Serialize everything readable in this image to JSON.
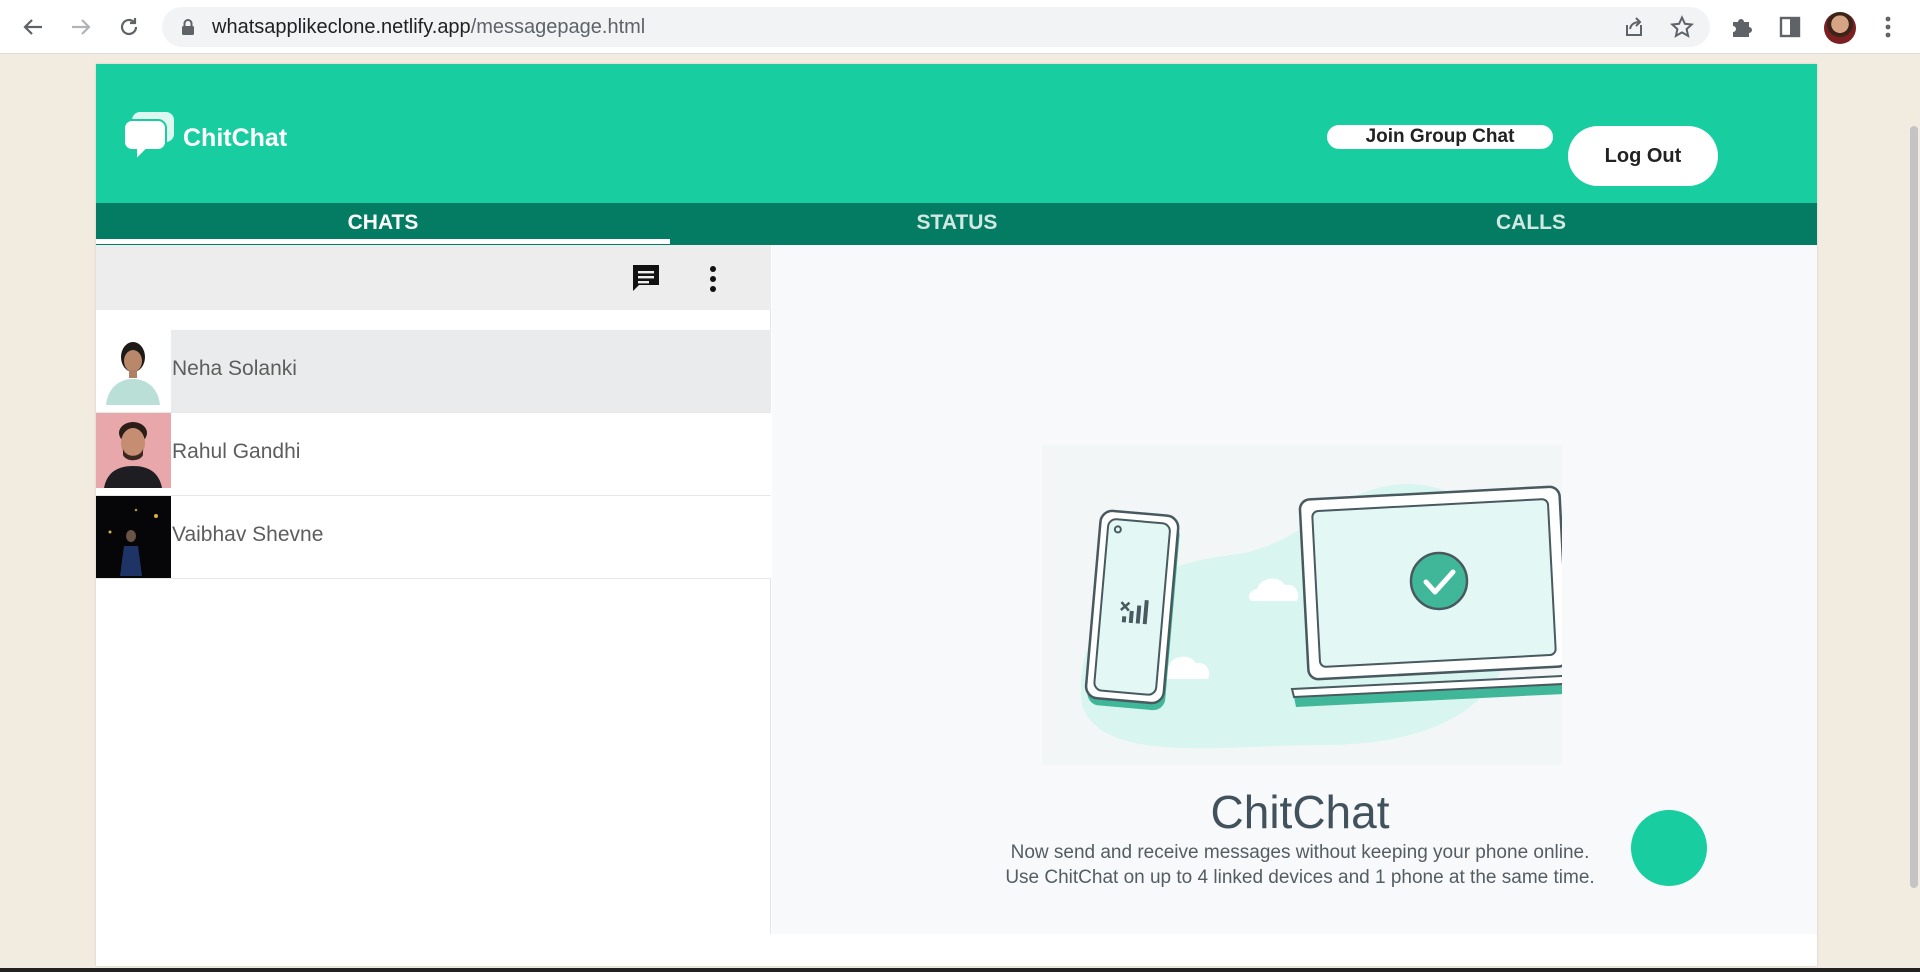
{
  "browser": {
    "url_domain": "whatsapplikeclone.netlify.app",
    "url_path": "/messagepage.html",
    "icons": [
      "back-arrow-icon",
      "forward-arrow-icon",
      "reload-icon",
      "lock-icon",
      "share-icon",
      "star-icon",
      "puzzle-icon",
      "side-panel-icon",
      "profile-avatar",
      "kebab-menu-icon"
    ]
  },
  "app": {
    "brand": "ChitChat",
    "header_buttons": {
      "join_group": "Join Group Chat",
      "logout": "Log Out"
    },
    "tabs": [
      {
        "label": "CHATS",
        "active": true
      },
      {
        "label": "STATUS",
        "active": false
      },
      {
        "label": "CALLS",
        "active": false
      }
    ],
    "chats": [
      {
        "name": "Neha Solanki",
        "selected": true
      },
      {
        "name": "Rahul Gandhi",
        "selected": false
      },
      {
        "name": "Vaibhav Shevne",
        "selected": false
      }
    ],
    "welcome": {
      "title": "ChitChat",
      "line1": "Now send and receive messages without keeping your phone online.",
      "line2": "Use ChitChat on up to 4 linked devices and 1 phone at the same time."
    },
    "colors": {
      "primary": "#18cda0",
      "tab_bar": "#047c64"
    }
  }
}
